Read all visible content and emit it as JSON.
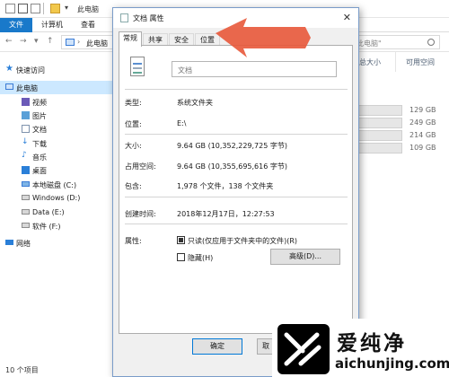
{
  "explorer": {
    "title": "此电脑",
    "ribbon_tabs": [
      "文件",
      "计算机",
      "查看"
    ],
    "address": {
      "path": "此电脑"
    },
    "search": {
      "placeholder": "此电脑\""
    },
    "columns": [
      "总大小",
      "可用空间"
    ],
    "nav": {
      "quick_access": "快速访问",
      "this_pc": "此电脑",
      "videos": "视频",
      "pictures": "图片",
      "documents": "文档",
      "downloads": "下载",
      "music": "音乐",
      "desktop": "桌面",
      "drive_c": "本地磁盘 (C:)",
      "drive_d": "Windows (D:)",
      "drive_e": "Data (E:)",
      "drive_f": "软件 (F:)",
      "network": "网络"
    },
    "drive_sizes": [
      "129 GB",
      "249 GB",
      "214 GB",
      "109 GB"
    ],
    "status": {
      "item_count": "10 个项目"
    }
  },
  "dialog": {
    "title": "文档 属性",
    "tabs": [
      "常规",
      "共享",
      "安全",
      "位置"
    ],
    "folder_name": "文档",
    "props": {
      "type_label": "类型:",
      "type_value": "系统文件夹",
      "location_label": "位置:",
      "location_value": "E:\\",
      "size_label": "大小:",
      "size_value": "9.64 GB (10,352,229,725 字节)",
      "disk_size_label": "占用空间:",
      "disk_size_value": "9.64 GB (10,355,695,616 字节)",
      "contains_label": "包含:",
      "contains_value": "1,978 个文件，138 个文件夹",
      "created_label": "创建时间:",
      "created_value": "2018年12月17日，12:27:53",
      "attributes_label": "属性:"
    },
    "attributes": {
      "readonly_label": "只读(仅应用于文件夹中的文件)(R)",
      "readonly_state": "indeterminate",
      "hidden_label": "隐藏(H)",
      "hidden_state": "unchecked",
      "advanced_label": "高级(D)..."
    },
    "buttons": {
      "ok": "确定",
      "cancel": "取"
    }
  },
  "watermark": {
    "title": "爱纯净",
    "url": "aichunjing.com"
  },
  "colors": {
    "accent": "#1979ca",
    "arrow": "#e8583a",
    "selection": "#cce8ff"
  }
}
